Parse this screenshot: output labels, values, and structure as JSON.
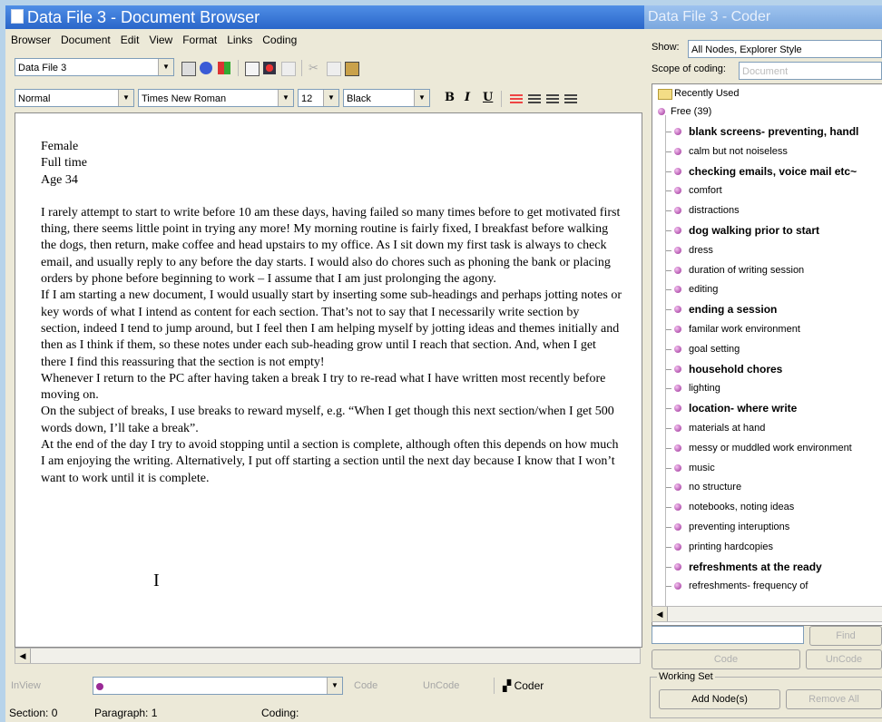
{
  "doc_window": {
    "title": "Data File 3 - Document Browser",
    "menu": [
      "Browser",
      "Document",
      "Edit",
      "View",
      "Format",
      "Links",
      "Coding"
    ],
    "document_select": "Data File 3",
    "style_select": "Normal",
    "font_select": "Times New Roman",
    "size_select": "12",
    "color_select": "Black",
    "format_buttons": {
      "bold": "B",
      "italic": "I",
      "underline": "U"
    },
    "text": {
      "header_lines": [
        "Female",
        "Full time",
        "Age 34"
      ],
      "paragraphs": [
        "I rarely attempt to start to write before 10 am these days, having failed so many times before to get motivated first thing, there seems little point in trying any more!  My morning routine is fairly fixed, I breakfast before walking the dogs, then return, make coffee and head upstairs to my office.  As I sit down my first task is always to check email, and usually reply to any before the day starts.  I would also do chores such as phoning the bank or placing orders by phone before beginning to work – I assume that I am just prolonging the agony.",
        "If I am starting a new document, I would usually start by inserting some sub-headings and perhaps jotting notes or key words of what I intend as content for each section.  That’s not to say that I necessarily write section by section, indeed I tend to jump around, but I feel then I am helping myself by jotting ideas and themes initially and then as I think if them, so these notes under each sub-heading grow until I reach that section.  And, when I get there I find this reassuring that the section is not empty!",
        "Whenever I return to the PC after having taken a break I try to re-read what I have written most recently before moving on.",
        "On the subject of breaks, I use breaks to reward myself, e.g. “When I get though this next section/when I get 500 words down, I’ll take a break”.",
        "At the end of the day I try to avoid stopping until a section is complete, although often this depends on how much I am enjoying the writing.  Alternatively, I put off starting a section until the next day because I know that I won’t want to work until it is complete."
      ]
    },
    "coder_bar": {
      "inview": "InView",
      "code": "Code",
      "uncode": "UnCode",
      "coder": "Coder"
    },
    "status": {
      "section": "Section: 0",
      "paragraph": "Paragraph: 1",
      "coding": "Coding:"
    }
  },
  "coder_window": {
    "title": "Data File 3 - Coder",
    "show_label": "Show:",
    "show_value": "All Nodes, Explorer Style",
    "scope_label": "Scope of coding:",
    "scope_value": "Document",
    "tree": {
      "recently_used": "Recently Used",
      "free": "Free (39)",
      "nodes": [
        {
          "label": "blank screens- preventing, handl",
          "bold": true
        },
        {
          "label": "calm but not noiseless",
          "bold": false
        },
        {
          "label": "checking emails, voice mail etc~",
          "bold": true
        },
        {
          "label": "comfort",
          "bold": false
        },
        {
          "label": "distractions",
          "bold": false
        },
        {
          "label": "dog walking prior to start",
          "bold": true
        },
        {
          "label": "dress",
          "bold": false
        },
        {
          "label": "duration of writing session",
          "bold": false
        },
        {
          "label": "editing",
          "bold": false
        },
        {
          "label": "ending a session",
          "bold": true
        },
        {
          "label": "familar work environment",
          "bold": false
        },
        {
          "label": "goal setting",
          "bold": false
        },
        {
          "label": "household chores",
          "bold": true
        },
        {
          "label": "lighting",
          "bold": false
        },
        {
          "label": "location-  where write",
          "bold": true
        },
        {
          "label": "materials at hand",
          "bold": false
        },
        {
          "label": "messy or muddled work environment",
          "bold": false
        },
        {
          "label": "music",
          "bold": false
        },
        {
          "label": "no structure",
          "bold": false
        },
        {
          "label": "notebooks, noting ideas",
          "bold": false
        },
        {
          "label": "preventing interuptions",
          "bold": false
        },
        {
          "label": "printing hardcopies",
          "bold": false
        },
        {
          "label": "refreshments at the ready",
          "bold": true
        },
        {
          "label": "refreshments- frequency of",
          "bold": false
        }
      ]
    },
    "find_button": "Find",
    "code_button": "Code",
    "uncode_button": "UnCode",
    "working_set_label": "Working Set",
    "add_nodes_button": "Add Node(s)",
    "remove_button": "Remove All"
  }
}
